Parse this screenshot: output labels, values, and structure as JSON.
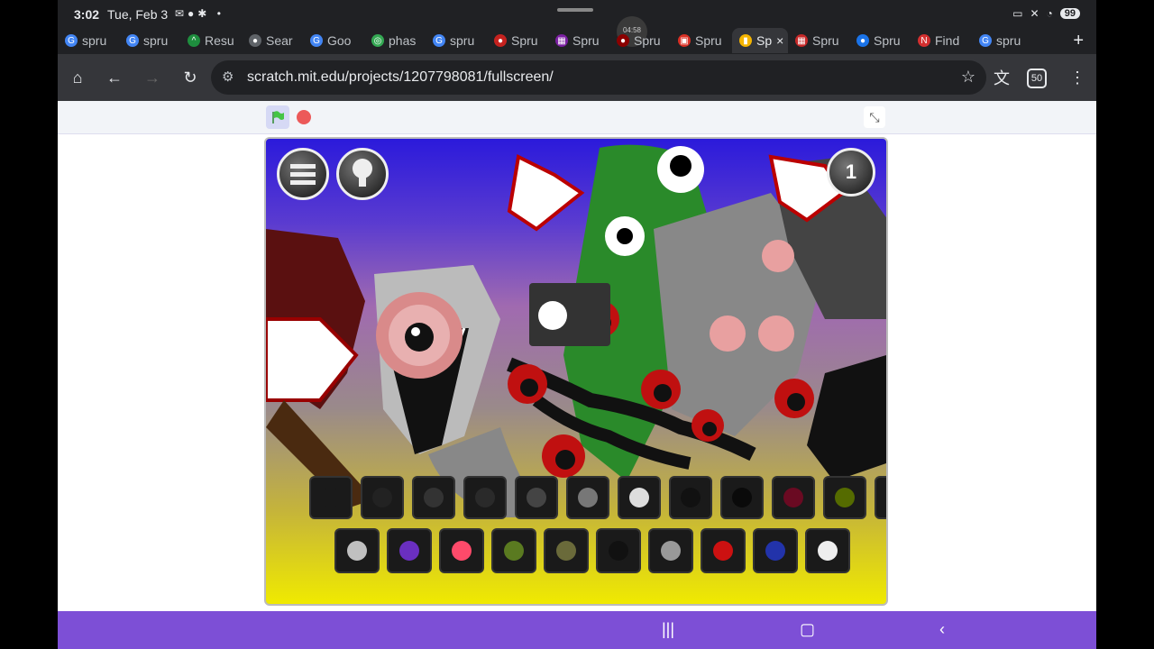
{
  "status": {
    "time": "3:02",
    "date": "Tue, Feb 3",
    "battery": "99",
    "recording": "04:58"
  },
  "tabs": [
    {
      "label": "spru",
      "fav": "G",
      "color": "#4285f4"
    },
    {
      "label": "spru",
      "fav": "G",
      "color": "#4285f4"
    },
    {
      "label": "Resu",
      "fav": "^",
      "color": "#1e8e3e"
    },
    {
      "label": "Sear",
      "fav": "●",
      "color": "#5f6368"
    },
    {
      "label": "Goo",
      "fav": "G",
      "color": "#4285f4"
    },
    {
      "label": "phas",
      "fav": "◎",
      "color": "#34a853"
    },
    {
      "label": "spru",
      "fav": "G",
      "color": "#4285f4"
    },
    {
      "label": "Spru",
      "fav": "●",
      "color": "#c5221f"
    },
    {
      "label": "Spru",
      "fav": "▦",
      "color": "#7b1fa2"
    },
    {
      "label": "Spru",
      "fav": "●",
      "color": "#8b0000"
    },
    {
      "label": "Spru",
      "fav": "▣",
      "color": "#d93025"
    },
    {
      "label": "Sp",
      "fav": "▮",
      "color": "#f4b400",
      "active": true
    },
    {
      "label": "Spru",
      "fav": "▦",
      "color": "#c62828"
    },
    {
      "label": "Spru",
      "fav": "●",
      "color": "#1a73e8"
    },
    {
      "label": "Find",
      "fav": "N",
      "color": "#d32f2f"
    },
    {
      "label": "spru",
      "fav": "G",
      "color": "#4285f4"
    }
  ],
  "omnibox": {
    "url": "scratch.mit.edu/projects/1207798081/fullscreen/"
  },
  "toolbar_right": {
    "tab_count": "50"
  },
  "game": {
    "timer": "1"
  },
  "icons": {
    "home": "home-icon",
    "back": "back-icon",
    "forward": "forward-icon",
    "reload": "reload-icon",
    "star": "star-icon",
    "translate": "translate-icon",
    "menu": "menu-icon",
    "flag": "green-flag-icon",
    "stop": "stop-icon",
    "exit_fullscreen": "exit-fullscreen-icon"
  },
  "colors": {
    "accent": "#7d4fd6",
    "flag": "#45c545",
    "stop": "#ec5959"
  },
  "game_slots_row1": [
    "#1a1a1a",
    "#222",
    "#333",
    "#2a2a2a",
    "#444",
    "#777",
    "#ddd",
    "#111",
    "#0a0a0a",
    "#6a0a22",
    "#556b00",
    "#3a3a3a"
  ],
  "game_slots_row2": [
    "#c0c0c0",
    "#6a2fc0",
    "#ff4a6a",
    "#5a7a20",
    "#6a6a3a",
    "#111",
    "#999",
    "#c11",
    "#2233aa",
    "#eee"
  ]
}
